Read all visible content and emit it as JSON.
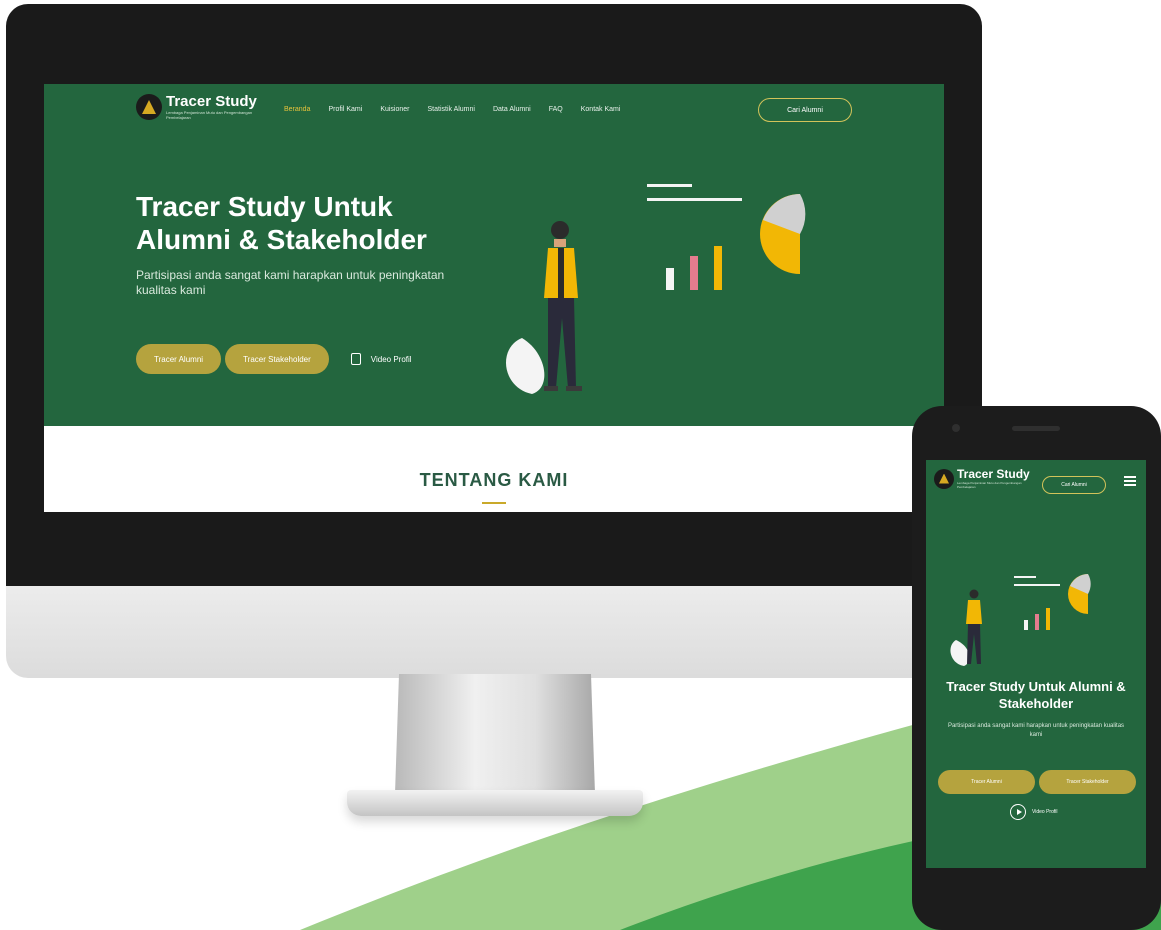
{
  "desktop": {
    "brand": {
      "title": "Tracer Study",
      "subtitle": "Lembaga Penjaminan Mutu dan Pengembangan Pembelajaran"
    },
    "nav": {
      "items": [
        "Beranda",
        "Profil Kami",
        "Kuisioner",
        "Statistik Alumni",
        "Data Alumni",
        "FAQ",
        "Kontak Kami"
      ],
      "active_index": 0,
      "cta_label": "Cari Alumni"
    },
    "hero": {
      "title_line1": "Tracer Study Untuk",
      "title_line2": "Alumni & Stakeholder",
      "description": "Partisipasi anda sangat kami harapkan untuk peningkatan kualitas kami",
      "button_alumni": "Tracer Alumni",
      "button_stakeholder": "Tracer Stakeholder",
      "video_label": "Video Profil"
    },
    "about": {
      "title": "TENTANG KAMI"
    }
  },
  "mobile": {
    "brand": {
      "title": "Tracer Study",
      "subtitle": "Lembaga Penjaminan Mutu dan Pengembangan Pembelajaran"
    },
    "cta_label": "Cari Alumni",
    "hero": {
      "title_line1": "Tracer Study Untuk Alumni &",
      "title_line2": "Stakeholder",
      "description": "Partisipasi anda sangat kami harapkan untuk peningkatan kualitas kami",
      "button_alumni": "Tracer Alumni",
      "button_stakeholder": "Tracer Stakeholder",
      "video_label": "Video Profil"
    }
  },
  "colors": {
    "hero_green": "#23663e",
    "accent_olive": "#b5a33e",
    "accent_yellow": "#f2b705",
    "swoosh_green": "#3fa34d",
    "swoosh_light": "#9fd08a"
  },
  "icons": [
    "logo-emblem-icon",
    "video-play-icon",
    "hamburger-menu-icon"
  ]
}
